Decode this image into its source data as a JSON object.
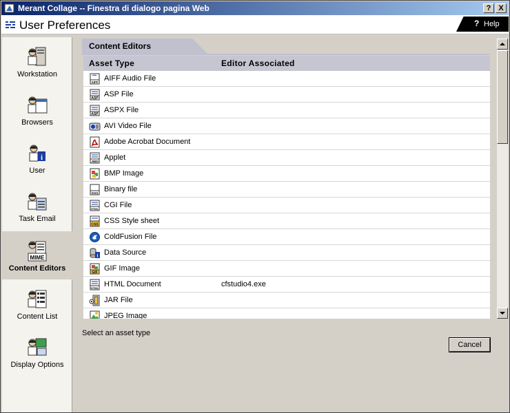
{
  "window": {
    "title": "Merant Collage -- Finestra di dialogo pagina Web",
    "help_btn": "?",
    "close_btn": "X"
  },
  "header": {
    "title": "User Preferences",
    "help_label": "Help",
    "help_icon": "?"
  },
  "sidebar": {
    "items": [
      {
        "label": "Workstation",
        "icon": "workstation-icon"
      },
      {
        "label": "Browsers",
        "icon": "browsers-icon"
      },
      {
        "label": "User",
        "icon": "user-icon"
      },
      {
        "label": "Task Email",
        "icon": "task-email-icon"
      },
      {
        "label": "Content Editors",
        "icon": "mime-icon",
        "active": true
      },
      {
        "label": "Content List",
        "icon": "content-list-icon"
      },
      {
        "label": "Display Options",
        "icon": "display-options-icon"
      }
    ]
  },
  "panel": {
    "tab": "Content Editors",
    "columns": {
      "asset_type": "Asset Type",
      "editor": "Editor Associated"
    },
    "rows": [
      {
        "name": "AIFF Audio File",
        "editor": "",
        "icon": "aiff-icon",
        "badge": "AIFF"
      },
      {
        "name": "ASP File",
        "editor": "",
        "icon": "asp-icon",
        "badge": "ASP"
      },
      {
        "name": "ASPX File",
        "editor": "",
        "icon": "aspx-icon",
        "badge": "ASP"
      },
      {
        "name": "AVI Video File",
        "editor": "",
        "icon": "avi-icon",
        "badge": ""
      },
      {
        "name": "Adobe Acrobat Document",
        "editor": "",
        "icon": "pdf-icon",
        "badge": ""
      },
      {
        "name": "Applet",
        "editor": "",
        "icon": "applet-icon",
        "badge": "JNDI"
      },
      {
        "name": "BMP Image",
        "editor": "",
        "icon": "bmp-icon",
        "badge": ""
      },
      {
        "name": "Binary file",
        "editor": "",
        "icon": "binary-icon",
        "badge": "0101"
      },
      {
        "name": "CGI File",
        "editor": "",
        "icon": "cgi-icon",
        "badge": "HTML"
      },
      {
        "name": "CSS Style sheet",
        "editor": "",
        "icon": "css-icon",
        "badge": "CSS"
      },
      {
        "name": "ColdFusion File",
        "editor": "",
        "icon": "coldfusion-icon",
        "badge": ""
      },
      {
        "name": "Data Source",
        "editor": "",
        "icon": "data-source-icon",
        "badge": ""
      },
      {
        "name": "GIF Image",
        "editor": "",
        "icon": "gif-icon",
        "badge": "GIF"
      },
      {
        "name": "HTML Document",
        "editor": "cfstudio4.exe",
        "icon": "html-icon",
        "badge": "HTML"
      },
      {
        "name": "JAR File",
        "editor": "",
        "icon": "jar-icon",
        "badge": ""
      },
      {
        "name": "JPEG Image",
        "editor": "",
        "icon": "jpeg-icon",
        "badge": ""
      }
    ]
  },
  "status_text": "Select an asset type",
  "buttons": {
    "cancel": "Cancel"
  },
  "colors": {
    "titlebar_start": "#0a246a",
    "titlebar_end": "#a6caf0",
    "tab": "#c0c0cf",
    "header_row": "#c6c6d2",
    "dialog": "#d4d0c8"
  }
}
